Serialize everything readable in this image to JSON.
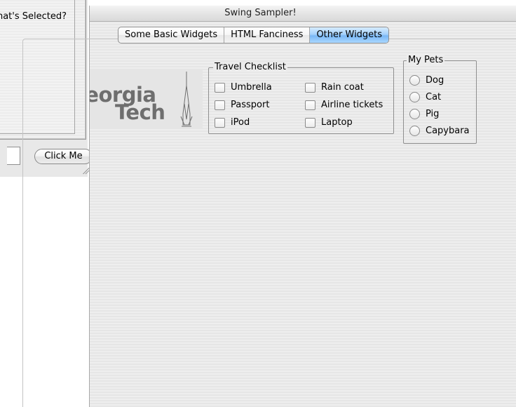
{
  "back_window": {
    "heading": "What's Selected?",
    "click_button_label": "Click Me"
  },
  "window": {
    "title": "Swing Sampler!"
  },
  "tabs": [
    {
      "label": "Some Basic Widgets",
      "selected": false
    },
    {
      "label": "HTML Fanciness",
      "selected": false
    },
    {
      "label": "Other Widgets",
      "selected": true
    }
  ],
  "logo": {
    "line1": "Georgia",
    "line2": "Tech"
  },
  "travel_checklist": {
    "title": "Travel Checklist",
    "items": [
      {
        "label": "Umbrella",
        "checked": false
      },
      {
        "label": "Passport",
        "checked": false
      },
      {
        "label": "iPod",
        "checked": false
      },
      {
        "label": "Rain coat",
        "checked": false
      },
      {
        "label": "Airline tickets",
        "checked": false
      },
      {
        "label": "Laptop",
        "checked": false
      }
    ]
  },
  "my_pets": {
    "title": "My Pets",
    "options": [
      {
        "label": "Dog",
        "selected": false
      },
      {
        "label": "Cat",
        "selected": false
      },
      {
        "label": "Pig",
        "selected": false
      },
      {
        "label": "Capybara",
        "selected": false
      }
    ]
  },
  "colors": {
    "active_tab": "#79b7f5",
    "logo_text": "#6e6e6e",
    "window_bg": "#eeeeee"
  }
}
